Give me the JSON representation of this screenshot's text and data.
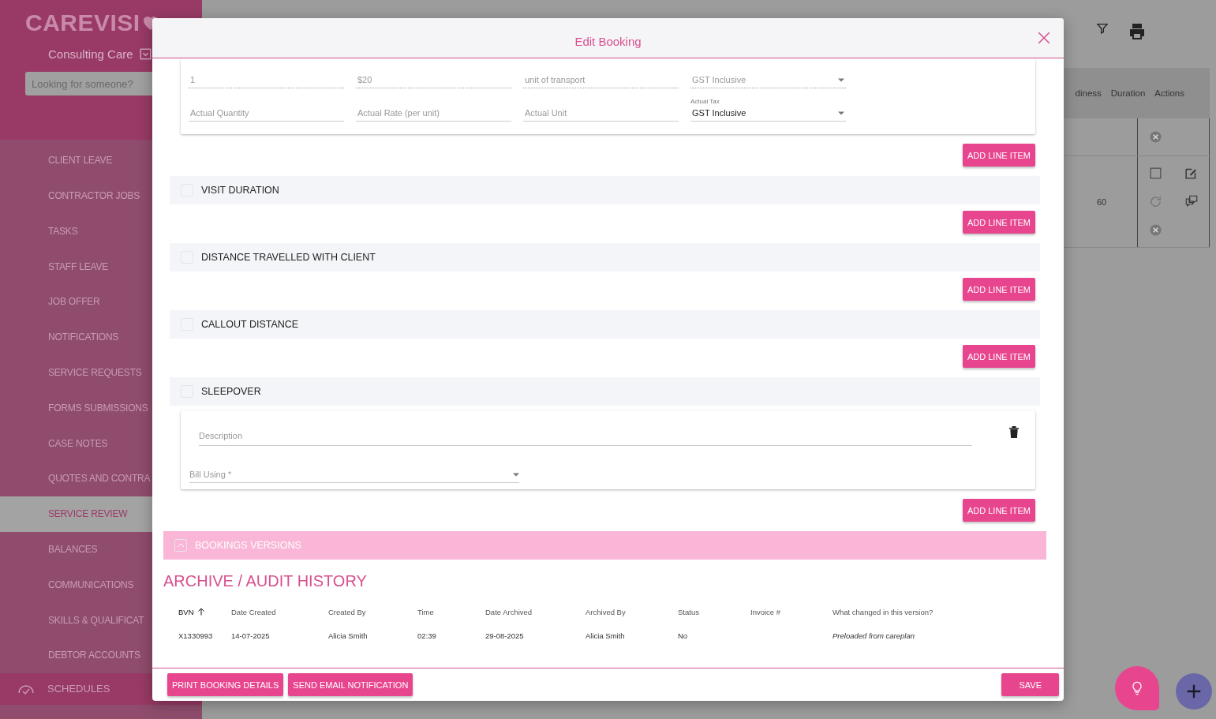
{
  "sidebar": {
    "logo": "CAREVISI",
    "organization": "Consulting Care",
    "search": {
      "placeholder": "Looking for someone?"
    },
    "items": [
      {
        "label": "CLIENT LEAVE",
        "selected": false
      },
      {
        "label": "CONTRACTOR JOBS",
        "selected": false
      },
      {
        "label": "TASKS",
        "selected": false
      },
      {
        "label": "STAFF LEAVE",
        "selected": false
      },
      {
        "label": "JOB OFFER",
        "selected": false
      },
      {
        "label": "NOTIFICATIONS",
        "selected": false
      },
      {
        "label": "SERVICE REQUESTS",
        "selected": false
      },
      {
        "label": "FORMS SUBMISSIONS",
        "selected": false
      },
      {
        "label": "CASE NOTES",
        "selected": false
      },
      {
        "label": "QUOTES AND CONTRA",
        "selected": false
      },
      {
        "label": "SERVICE REVIEW",
        "selected": true
      },
      {
        "label": "BALANCES",
        "selected": false
      },
      {
        "label": "COMMUNICATIONS",
        "selected": false
      },
      {
        "label": "SKILLS & QUALIFICAT",
        "selected": false
      },
      {
        "label": "DEBTOR ACCOUNTS",
        "selected": false
      }
    ],
    "footer_item": {
      "label": "SCHEDULES"
    }
  },
  "background_table": {
    "columns": [
      "diness",
      "Duration",
      "Actions"
    ],
    "rows": [
      {
        "duration": ""
      },
      {
        "duration": "60"
      }
    ]
  },
  "modal": {
    "title": "Edit Booking",
    "sections": [
      {
        "entries": [
          {
            "kind": "line_item",
            "rows": [
              [
                {
                  "kind": "text",
                  "value": "1",
                  "disabled": true
                },
                {
                  "kind": "text",
                  "value": "$20",
                  "disabled": true
                },
                {
                  "kind": "text",
                  "value": "unit of transport",
                  "disabled": true
                },
                {
                  "kind": "select",
                  "value": "GST Inclusive",
                  "disabled": true
                }
              ],
              [
                {
                  "kind": "text",
                  "placeholder": "Actual Quantity",
                  "disabled": false
                },
                {
                  "kind": "text",
                  "placeholder": "Actual Rate (per unit)",
                  "disabled": false
                },
                {
                  "kind": "text",
                  "placeholder": "Actual Unit",
                  "disabled": false
                },
                {
                  "kind": "select",
                  "label": "Actual Tax",
                  "value": "GST Inclusive",
                  "disabled": false
                }
              ]
            ]
          }
        ],
        "button": "ADD LINE ITEM"
      },
      {
        "title": "VISIT DURATION",
        "checked": false,
        "button": "ADD LINE ITEM"
      },
      {
        "title": "DISTANCE TRAVELLED WITH CLIENT",
        "checked": false,
        "button": "ADD LINE ITEM"
      },
      {
        "title": "CALLOUT DISTANCE",
        "checked": false,
        "button": "ADD LINE ITEM"
      },
      {
        "title": "SLEEPOVER",
        "checked": false,
        "entries": [
          {
            "kind": "description",
            "description": {
              "placeholder": "Description"
            },
            "bill_using": {
              "placeholder": "Bill Using *"
            }
          }
        ],
        "button": "ADD LINE ITEM"
      }
    ],
    "versions": {
      "label": "BOOKINGS VERSIONS",
      "expanded": false
    },
    "archive": {
      "title": "ARCHIVE / AUDIT HISTORY",
      "columns": [
        {
          "label": "BVN",
          "sorted": true
        },
        {
          "label": "Date Created",
          "sorted": false
        },
        {
          "label": "Created By",
          "sorted": false
        },
        {
          "label": "Time",
          "sorted": false
        },
        {
          "label": "Date Archived",
          "sorted": false
        },
        {
          "label": "Archived By",
          "sorted": false
        },
        {
          "label": "Status",
          "sorted": false
        },
        {
          "label": "Invoice #",
          "sorted": false
        },
        {
          "label": "What changed in this version?",
          "sorted": false
        }
      ],
      "rows": [
        [
          "X1330993",
          "14-07-2025",
          "Alicia Smith",
          "02:39",
          "29-08-2025",
          "Alicia Smith",
          "No",
          "",
          "Preloaded from careplan"
        ]
      ]
    },
    "footer_buttons": [
      "PRINT BOOKING DETAILS",
      "SEND EMAIL NOTIFICATION"
    ],
    "save_button": "SAVE"
  }
}
